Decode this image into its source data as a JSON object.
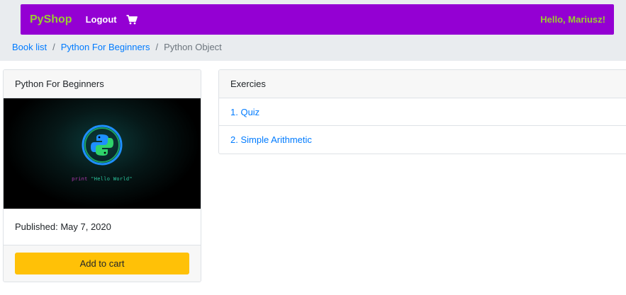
{
  "navbar": {
    "brand": "PyShop",
    "logout_label": "Logout",
    "cart_icon": "cart-icon",
    "greeting": "Hello, Mariusz!",
    "bg_color": "#9400d3",
    "accent_color": "#9acd32"
  },
  "breadcrumb": {
    "items": [
      {
        "label": "Book list"
      },
      {
        "label": "Python For Beginners"
      }
    ],
    "separator": "/",
    "active": "Python Object"
  },
  "book_card": {
    "title": "Python For Beginners",
    "cover_code_keyword": "print",
    "cover_code_string": "\"Hello World\"",
    "published": "Published: May 7, 2020",
    "add_to_cart_label": "Add to cart",
    "button_color": "#ffc107"
  },
  "exercises": {
    "title": "Exercies",
    "items": [
      {
        "label": "1. Quiz"
      },
      {
        "label": "2. Simple Arithmetic"
      }
    ]
  }
}
